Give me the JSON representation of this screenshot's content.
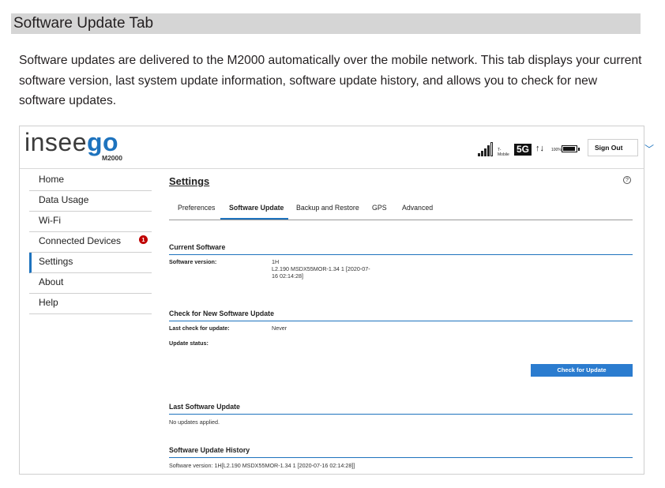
{
  "section": {
    "title": "Software Update Tab"
  },
  "intro": "Software updates are delivered to the M2000 automatically over the mobile network. This tab displays your current software version, last system update information, software update history, and allows you to check for new software updates.",
  "header": {
    "logo_prefix": "insee",
    "logo_suffix": "go",
    "model": "M2000",
    "carrier": "T-Mobile",
    "network": "5G",
    "traffic": "↑↓",
    "battery_pct_label": "100%",
    "battery_level": 1.0,
    "sign_out": "Sign Out",
    "chevron": "﹀"
  },
  "nav": [
    {
      "label": "Home"
    },
    {
      "label": "Data Usage"
    },
    {
      "label": "Wi-Fi"
    },
    {
      "label": "Connected Devices",
      "badge": "1"
    },
    {
      "label": "Settings",
      "active": true
    },
    {
      "label": "About"
    },
    {
      "label": "Help"
    }
  ],
  "main": {
    "title": "Settings",
    "help": "?",
    "tabs": [
      "Preferences",
      "Software Update",
      "Backup and Restore",
      "GPS",
      "Advanced"
    ],
    "current": {
      "heading": "Current Software",
      "version_label": "Software version:",
      "version_line1": "1H",
      "version_line2": "L2.190 MSDX55MOR-1.34 1 [2020-07-",
      "version_line3": "16 02:14:28]"
    },
    "check": {
      "heading": "Check for New Software Update",
      "last_label": "Last check for update:",
      "last_value": "Never",
      "status_label": "Update status:",
      "button": "Check for Update"
    },
    "last": {
      "heading": "Last Software Update",
      "text": "No updates applied."
    },
    "history": {
      "heading": "Software Update History",
      "text": "Software version:  1H[L2.190 MSDX55MOR-1.34 1 [2020-07-16 02:14:28]]"
    }
  }
}
